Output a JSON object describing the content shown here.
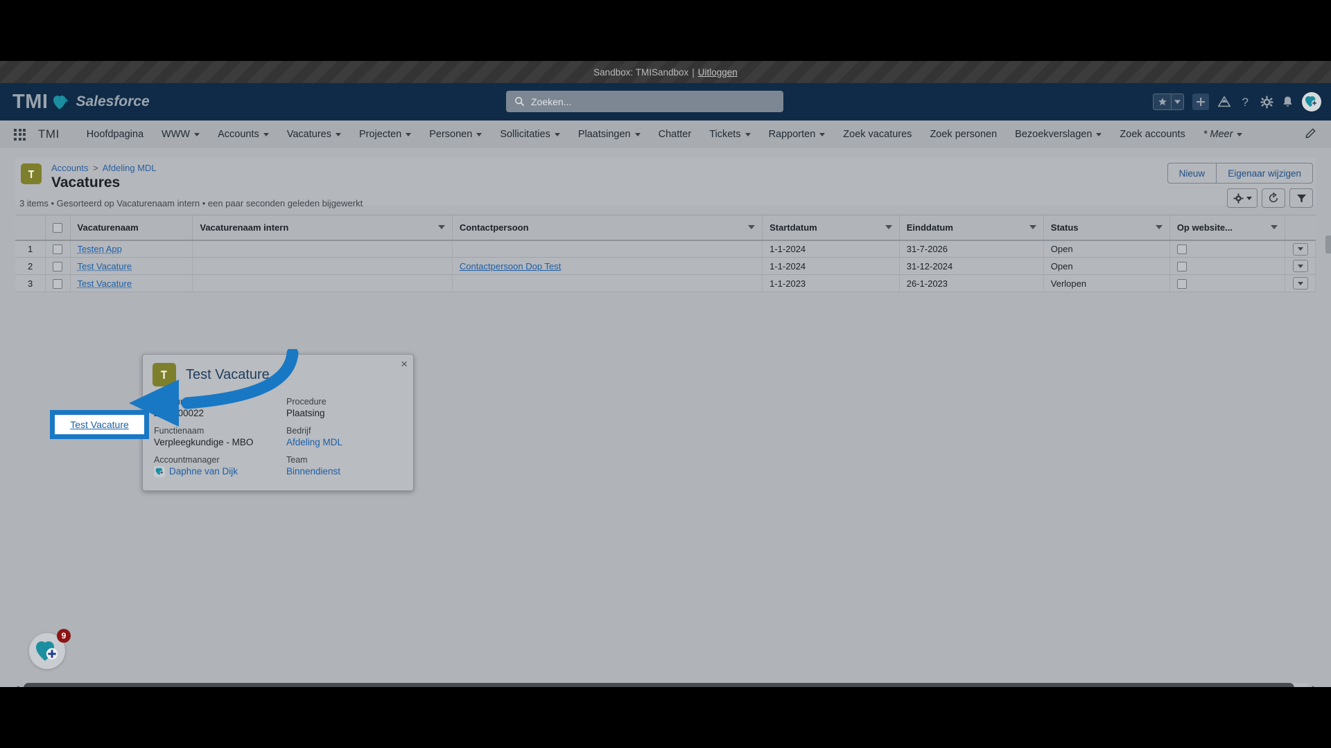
{
  "sandbox": {
    "text": "Sandbox: TMISandbox",
    "separator": "|",
    "logout_label": "Uitloggen"
  },
  "header": {
    "logo_primary": "TMI",
    "logo_secondary": "Salesforce",
    "search_placeholder": "Zoeken...",
    "search_value": "",
    "icons": [
      "favorites-star-icon",
      "favorites-caret-icon",
      "add-icon",
      "learning-icon",
      "help-icon",
      "setup-gear-icon",
      "notifications-bell-icon",
      "user-avatar"
    ]
  },
  "nav": {
    "app_name": "TMI",
    "items": [
      {
        "label": "Hoofdpagina",
        "has_menu": false
      },
      {
        "label": "WWW",
        "has_menu": true
      },
      {
        "label": "Accounts",
        "has_menu": true
      },
      {
        "label": "Vacatures",
        "has_menu": true
      },
      {
        "label": "Projecten",
        "has_menu": true
      },
      {
        "label": "Personen",
        "has_menu": true
      },
      {
        "label": "Sollicitaties",
        "has_menu": true
      },
      {
        "label": "Plaatsingen",
        "has_menu": true
      },
      {
        "label": "Chatter",
        "has_menu": false
      },
      {
        "label": "Tickets",
        "has_menu": true
      },
      {
        "label": "Rapporten",
        "has_menu": true
      },
      {
        "label": "Zoek vacatures",
        "has_menu": false
      },
      {
        "label": "Zoek personen",
        "has_menu": false
      },
      {
        "label": "Bezoekverslagen",
        "has_menu": true
      },
      {
        "label": "Zoek accounts",
        "has_menu": false
      },
      {
        "label": "* Meer",
        "has_menu": true
      }
    ]
  },
  "page": {
    "breadcrumb": {
      "parent": "Accounts",
      "separator": ">",
      "current": "Afdeling MDL"
    },
    "title": "Vacatures",
    "meta": "3 items • Gesorteerd op Vacaturenaam intern • een paar seconden geleden bijgewerkt",
    "buttons": {
      "new": "Nieuw",
      "change_owner": "Eigenaar wijzigen"
    },
    "tools": [
      "list-view-settings-gear-icon",
      "refresh-icon",
      "filter-icon"
    ]
  },
  "table": {
    "columns": [
      "Vacaturenaam",
      "Vacaturenaam intern",
      "Contactpersoon",
      "Startdatum",
      "Einddatum",
      "Status",
      "Op website..."
    ],
    "rows": [
      {
        "num": "1",
        "vacaturenaam": "Testen App",
        "vacaturenaam_intern": "",
        "contactpersoon": "",
        "startdatum": "1-1-2024",
        "einddatum": "31-7-2026",
        "status": "Open",
        "op_website": false
      },
      {
        "num": "2",
        "vacaturenaam": "Test Vacature",
        "vacaturenaam_intern": "",
        "contactpersoon": "Contactpersoon Dop Test",
        "startdatum": "1-1-2024",
        "einddatum": "31-12-2024",
        "status": "Open",
        "op_website": false
      },
      {
        "num": "3",
        "vacaturenaam": "Test Vacature",
        "vacaturenaam_intern": "",
        "contactpersoon": "",
        "startdatum": "1-1-2023",
        "einddatum": "26-1-2023",
        "status": "Verlopen",
        "op_website": false
      }
    ]
  },
  "popover": {
    "title": "Test Vacature",
    "close_label": "×",
    "fields": [
      {
        "label": "Vacaturenummer",
        "value": "2024-00022",
        "link": false
      },
      {
        "label": "Procedure",
        "value": "Plaatsing",
        "link": false
      },
      {
        "label": "Functienaam",
        "value": "Verpleegkundige - MBO",
        "link": false
      },
      {
        "label": "Bedrijf",
        "value": "Afdeling MDL",
        "link": true
      },
      {
        "label": "Accountmanager",
        "value": "Daphne van Dijk",
        "link": true,
        "avatar": true
      },
      {
        "label": "Team",
        "value": "Binnendienst",
        "link": true
      }
    ]
  },
  "annotation": {
    "highlight_label": "Test Vacature",
    "arrow_color": "#1878c4",
    "highlight_border_color": "#1878c4"
  },
  "help_widget": {
    "badge_count": "9",
    "icon": "heart-plus-icon"
  },
  "colors": {
    "header_bg": "#0f2b47",
    "object_icon": "#7e7f2c",
    "link": "#1d5fa8",
    "brand_teal": "#1b8fa0",
    "badge_red": "#8c1313"
  }
}
